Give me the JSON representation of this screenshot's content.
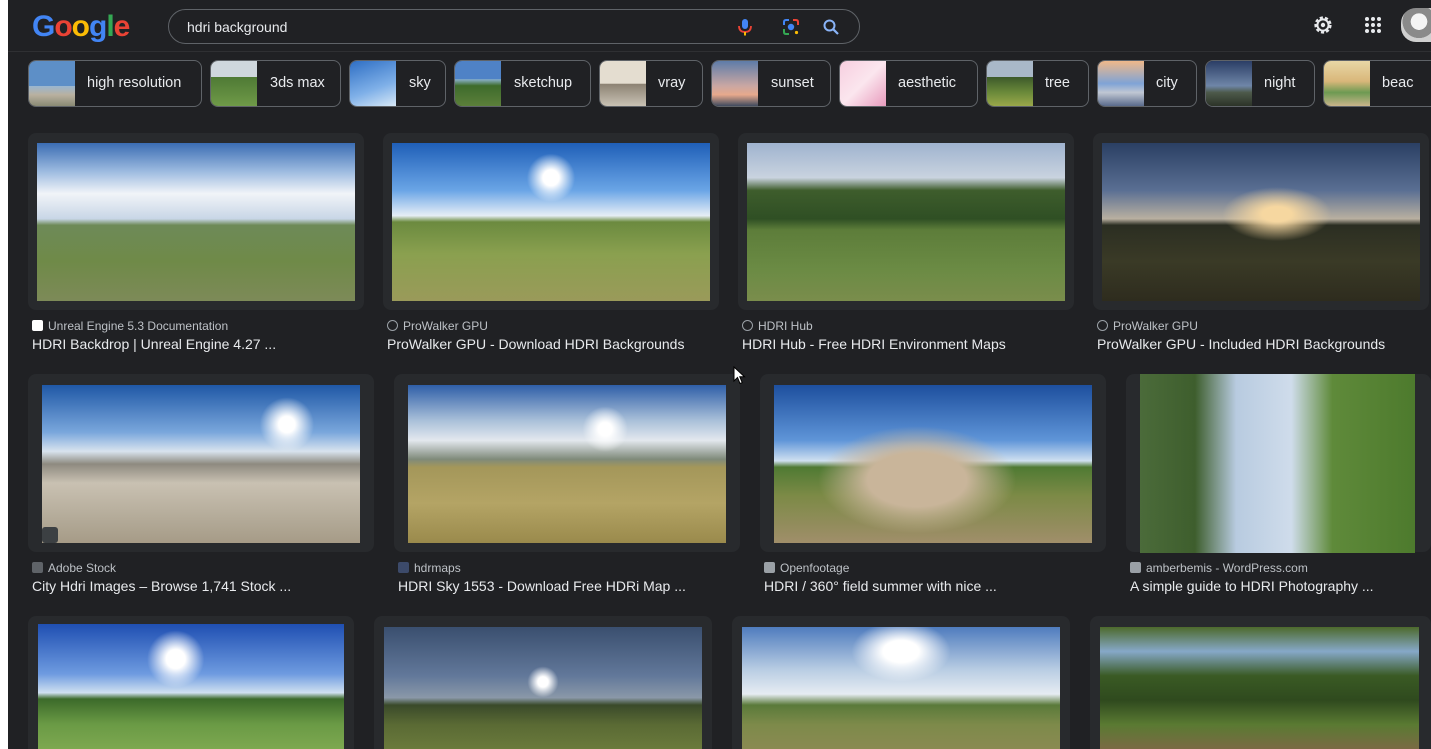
{
  "search": {
    "query": "hdri background"
  },
  "logo": {
    "letters": [
      "G",
      "o",
      "o",
      "g",
      "l",
      "e"
    ]
  },
  "chips": [
    {
      "label": "high resolution"
    },
    {
      "label": "3ds max"
    },
    {
      "label": "sky"
    },
    {
      "label": "sketchup"
    },
    {
      "label": "vray"
    },
    {
      "label": "sunset"
    },
    {
      "label": "aesthetic"
    },
    {
      "label": "tree"
    },
    {
      "label": "city"
    },
    {
      "label": "night"
    },
    {
      "label": "beac"
    }
  ],
  "results": [
    {
      "source": "Unreal Engine 5.3 Documentation",
      "title": "HDRI Backdrop | Unreal Engine 4.27 ..."
    },
    {
      "source": "ProWalker GPU",
      "title": "ProWalker GPU - Download HDRI Backgrounds"
    },
    {
      "source": "HDRI Hub",
      "title": "HDRI Hub - Free HDRI Environment Maps"
    },
    {
      "source": "ProWalker GPU",
      "title": "ProWalker GPU - Included HDRI Backgrounds"
    },
    {
      "source": "Adobe Stock",
      "title": "City Hdri Images – Browse 1,741 Stock ..."
    },
    {
      "source": "hdrmaps",
      "title": "HDRI Sky 1553 - Download Free HDRi Map ..."
    },
    {
      "source": "Openfootage",
      "title": "HDRI / 360° field summer with nice ..."
    },
    {
      "source": "amberbemis - WordPress.com",
      "title": "A simple guide to HDRI Photography ..."
    },
    {
      "source": "",
      "title": ""
    },
    {
      "source": "",
      "title": ""
    },
    {
      "source": "",
      "title": ""
    },
    {
      "source": "",
      "title": ""
    }
  ],
  "colors": {
    "background": "#202124",
    "card": "#282a2d",
    "text": "#e8eaed",
    "muted": "#bdc1c6",
    "outline": "#5f6368"
  }
}
